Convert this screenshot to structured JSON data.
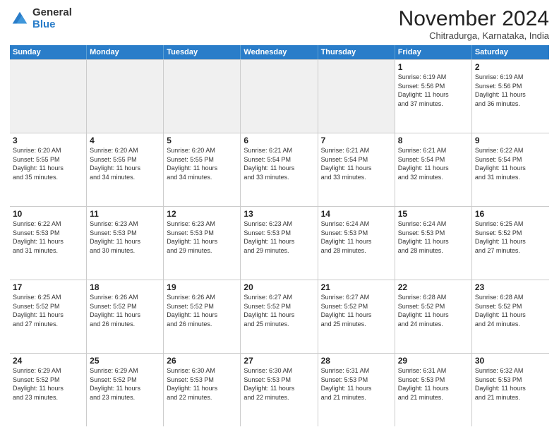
{
  "logo": {
    "general": "General",
    "blue": "Blue"
  },
  "title": "November 2024",
  "subtitle": "Chitradurga, Karnataka, India",
  "header_days": [
    "Sunday",
    "Monday",
    "Tuesday",
    "Wednesday",
    "Thursday",
    "Friday",
    "Saturday"
  ],
  "rows": [
    [
      {
        "day": "",
        "info": ""
      },
      {
        "day": "",
        "info": ""
      },
      {
        "day": "",
        "info": ""
      },
      {
        "day": "",
        "info": ""
      },
      {
        "day": "",
        "info": ""
      },
      {
        "day": "1",
        "info": "Sunrise: 6:19 AM\nSunset: 5:56 PM\nDaylight: 11 hours\nand 37 minutes."
      },
      {
        "day": "2",
        "info": "Sunrise: 6:19 AM\nSunset: 5:56 PM\nDaylight: 11 hours\nand 36 minutes."
      }
    ],
    [
      {
        "day": "3",
        "info": "Sunrise: 6:20 AM\nSunset: 5:55 PM\nDaylight: 11 hours\nand 35 minutes."
      },
      {
        "day": "4",
        "info": "Sunrise: 6:20 AM\nSunset: 5:55 PM\nDaylight: 11 hours\nand 34 minutes."
      },
      {
        "day": "5",
        "info": "Sunrise: 6:20 AM\nSunset: 5:55 PM\nDaylight: 11 hours\nand 34 minutes."
      },
      {
        "day": "6",
        "info": "Sunrise: 6:21 AM\nSunset: 5:54 PM\nDaylight: 11 hours\nand 33 minutes."
      },
      {
        "day": "7",
        "info": "Sunrise: 6:21 AM\nSunset: 5:54 PM\nDaylight: 11 hours\nand 33 minutes."
      },
      {
        "day": "8",
        "info": "Sunrise: 6:21 AM\nSunset: 5:54 PM\nDaylight: 11 hours\nand 32 minutes."
      },
      {
        "day": "9",
        "info": "Sunrise: 6:22 AM\nSunset: 5:54 PM\nDaylight: 11 hours\nand 31 minutes."
      }
    ],
    [
      {
        "day": "10",
        "info": "Sunrise: 6:22 AM\nSunset: 5:53 PM\nDaylight: 11 hours\nand 31 minutes."
      },
      {
        "day": "11",
        "info": "Sunrise: 6:23 AM\nSunset: 5:53 PM\nDaylight: 11 hours\nand 30 minutes."
      },
      {
        "day": "12",
        "info": "Sunrise: 6:23 AM\nSunset: 5:53 PM\nDaylight: 11 hours\nand 29 minutes."
      },
      {
        "day": "13",
        "info": "Sunrise: 6:23 AM\nSunset: 5:53 PM\nDaylight: 11 hours\nand 29 minutes."
      },
      {
        "day": "14",
        "info": "Sunrise: 6:24 AM\nSunset: 5:53 PM\nDaylight: 11 hours\nand 28 minutes."
      },
      {
        "day": "15",
        "info": "Sunrise: 6:24 AM\nSunset: 5:53 PM\nDaylight: 11 hours\nand 28 minutes."
      },
      {
        "day": "16",
        "info": "Sunrise: 6:25 AM\nSunset: 5:52 PM\nDaylight: 11 hours\nand 27 minutes."
      }
    ],
    [
      {
        "day": "17",
        "info": "Sunrise: 6:25 AM\nSunset: 5:52 PM\nDaylight: 11 hours\nand 27 minutes."
      },
      {
        "day": "18",
        "info": "Sunrise: 6:26 AM\nSunset: 5:52 PM\nDaylight: 11 hours\nand 26 minutes."
      },
      {
        "day": "19",
        "info": "Sunrise: 6:26 AM\nSunset: 5:52 PM\nDaylight: 11 hours\nand 26 minutes."
      },
      {
        "day": "20",
        "info": "Sunrise: 6:27 AM\nSunset: 5:52 PM\nDaylight: 11 hours\nand 25 minutes."
      },
      {
        "day": "21",
        "info": "Sunrise: 6:27 AM\nSunset: 5:52 PM\nDaylight: 11 hours\nand 25 minutes."
      },
      {
        "day": "22",
        "info": "Sunrise: 6:28 AM\nSunset: 5:52 PM\nDaylight: 11 hours\nand 24 minutes."
      },
      {
        "day": "23",
        "info": "Sunrise: 6:28 AM\nSunset: 5:52 PM\nDaylight: 11 hours\nand 24 minutes."
      }
    ],
    [
      {
        "day": "24",
        "info": "Sunrise: 6:29 AM\nSunset: 5:52 PM\nDaylight: 11 hours\nand 23 minutes."
      },
      {
        "day": "25",
        "info": "Sunrise: 6:29 AM\nSunset: 5:52 PM\nDaylight: 11 hours\nand 23 minutes."
      },
      {
        "day": "26",
        "info": "Sunrise: 6:30 AM\nSunset: 5:53 PM\nDaylight: 11 hours\nand 22 minutes."
      },
      {
        "day": "27",
        "info": "Sunrise: 6:30 AM\nSunset: 5:53 PM\nDaylight: 11 hours\nand 22 minutes."
      },
      {
        "day": "28",
        "info": "Sunrise: 6:31 AM\nSunset: 5:53 PM\nDaylight: 11 hours\nand 21 minutes."
      },
      {
        "day": "29",
        "info": "Sunrise: 6:31 AM\nSunset: 5:53 PM\nDaylight: 11 hours\nand 21 minutes."
      },
      {
        "day": "30",
        "info": "Sunrise: 6:32 AM\nSunset: 5:53 PM\nDaylight: 11 hours\nand 21 minutes."
      }
    ]
  ]
}
